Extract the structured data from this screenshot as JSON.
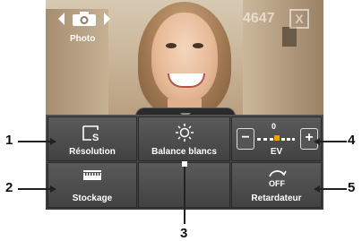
{
  "camera": {
    "mode_label": "Photo",
    "shots_remaining": "4647",
    "close_glyph": "X"
  },
  "menu": {
    "items": [
      {
        "label": "Résolution",
        "icon": "resolution-icon"
      },
      {
        "label": "Balance blancs",
        "icon": "white-balance-sun-icon"
      },
      {
        "label": "EV",
        "icon": "exposure-value-slider",
        "value": "0",
        "minus": "−",
        "plus": "+"
      },
      {
        "label": "Stockage",
        "icon": "storage-card-icon"
      },
      {
        "label": "",
        "icon": ""
      },
      {
        "label": "Retardateur",
        "icon": "self-timer-off-icon",
        "icon_text": "OFF"
      }
    ]
  },
  "callouts": [
    "1",
    "2",
    "3",
    "4",
    "5"
  ],
  "colors": {
    "accent": "#f0a000",
    "panel": "#444444"
  }
}
